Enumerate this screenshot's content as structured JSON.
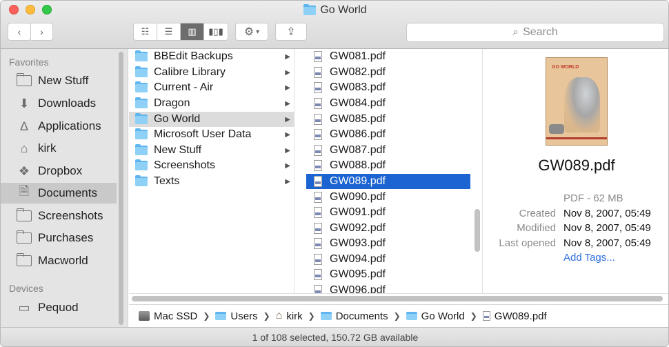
{
  "window": {
    "title": "Go World"
  },
  "toolbar": {
    "view_icons": [
      "icon-view-icon",
      "list-view-icon",
      "column-view-icon",
      "cover-flow-icon"
    ],
    "search_placeholder": "Search"
  },
  "sidebar": {
    "favorites_heading": "Favorites",
    "favorites": [
      {
        "label": "New Stuff",
        "icon": "folder-icon"
      },
      {
        "label": "Downloads",
        "icon": "downloads-icon"
      },
      {
        "label": "Applications",
        "icon": "applications-icon"
      },
      {
        "label": "kirk",
        "icon": "home-icon"
      },
      {
        "label": "Dropbox",
        "icon": "dropbox-icon"
      },
      {
        "label": "Documents",
        "icon": "documents-icon",
        "selected": true
      },
      {
        "label": "Screenshots",
        "icon": "folder-icon"
      },
      {
        "label": "Purchases",
        "icon": "folder-icon"
      },
      {
        "label": "Macworld",
        "icon": "folder-icon"
      }
    ],
    "devices_heading": "Devices",
    "devices": [
      {
        "label": "Pequod",
        "icon": "laptop-icon"
      }
    ]
  },
  "column1": {
    "items": [
      {
        "label": "BBEdit Backups"
      },
      {
        "label": "Calibre Library"
      },
      {
        "label": "Current - Air"
      },
      {
        "label": "Dragon"
      },
      {
        "label": "Go World",
        "highlighted": true
      },
      {
        "label": "Microsoft User Data"
      },
      {
        "label": "New Stuff"
      },
      {
        "label": "Screenshots"
      },
      {
        "label": "Texts"
      }
    ]
  },
  "column2": {
    "items": [
      "GW081.pdf",
      "GW082.pdf",
      "GW083.pdf",
      "GW084.pdf",
      "GW085.pdf",
      "GW086.pdf",
      "GW087.pdf",
      "GW088.pdf",
      "GW089.pdf",
      "GW090.pdf",
      "GW091.pdf",
      "GW092.pdf",
      "GW093.pdf",
      "GW094.pdf",
      "GW095.pdf",
      "GW096.pdf"
    ],
    "selected": "GW089.pdf"
  },
  "preview": {
    "cover_title": "GO WORLD",
    "filename": "GW089.pdf",
    "kind_size": "PDF - 62 MB",
    "created_label": "Created",
    "created_value": "Nov 8, 2007, 05:49",
    "modified_label": "Modified",
    "modified_value": "Nov 8, 2007, 05:49",
    "opened_label": "Last opened",
    "opened_value": "Nov 8, 2007, 05:49",
    "add_tags": "Add Tags..."
  },
  "pathbar": [
    {
      "label": "Mac SSD",
      "icon": "disk-icon"
    },
    {
      "label": "Users",
      "icon": "folder-icon"
    },
    {
      "label": "kirk",
      "icon": "home-icon"
    },
    {
      "label": "Documents",
      "icon": "folder-icon"
    },
    {
      "label": "Go World",
      "icon": "folder-icon"
    },
    {
      "label": "GW089.pdf",
      "icon": "pdf-icon"
    }
  ],
  "status": {
    "text": "1 of 108 selected, 150.72 GB available"
  },
  "colors": {
    "selection": "#1b64d1",
    "link": "#2f6fe0",
    "folder": "#8fd0f7"
  }
}
